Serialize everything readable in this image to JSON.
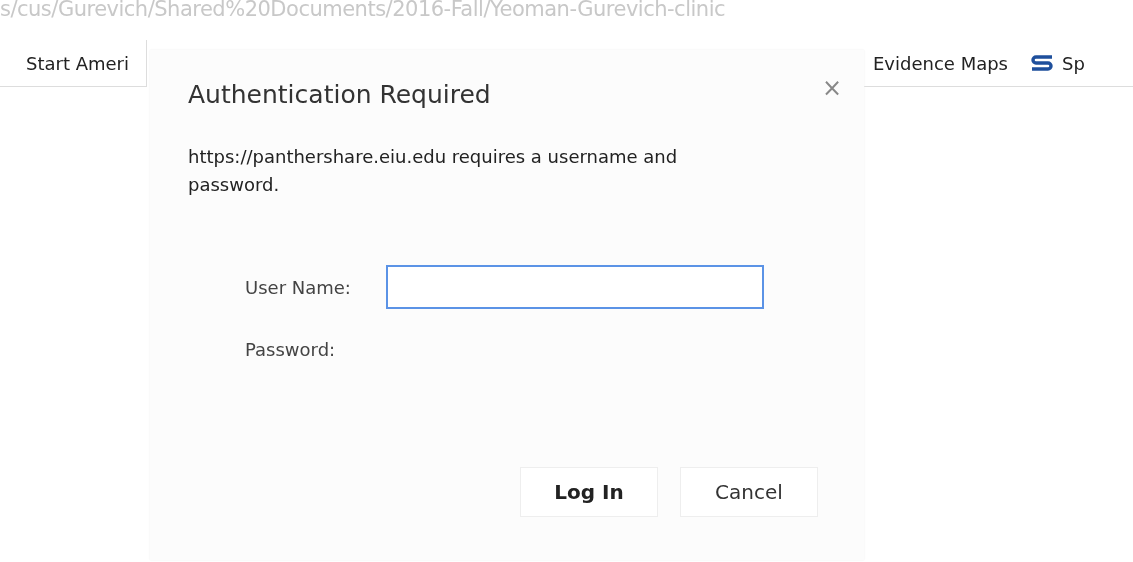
{
  "address_bar": {
    "url": "s/cus/Gurevich/Shared%20Documents/2016-Fall/Yeoman-Gurevich-clinic"
  },
  "bookmarks": {
    "left": [
      {
        "label": "Start Ameri"
      }
    ],
    "right": [
      {
        "label": "Evidence Maps",
        "kind": "text"
      },
      {
        "label": "Sp",
        "kind": "logo"
      }
    ]
  },
  "dialog": {
    "title": "Authentication Required",
    "close": "×",
    "message": "https://panthershare.eiu.edu requires a username and password.",
    "fields": [
      {
        "label": "User Name:",
        "focused": true
      },
      {
        "label": "Password:",
        "focused": false
      }
    ],
    "buttons": [
      {
        "label": "Log In",
        "default": true
      },
      {
        "label": "Cancel",
        "default": false
      }
    ]
  }
}
